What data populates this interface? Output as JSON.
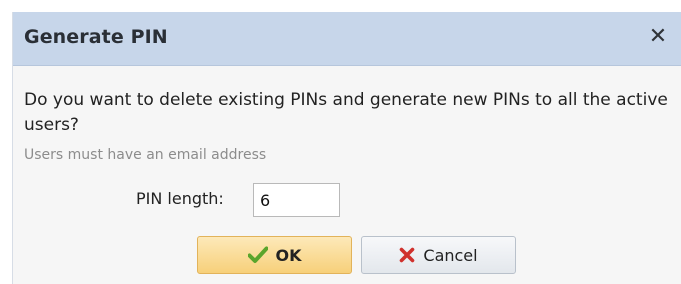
{
  "dialog": {
    "title": "Generate PIN",
    "close_icon": "close-icon",
    "question": "Do you want to delete existing PINs and generate new PINs to all the active users?",
    "hint": "Users must have an email address",
    "pin_length_label": "PIN length:",
    "pin_length_value": "6",
    "ok_label": "OK",
    "ok_icon": "checkmark-icon",
    "cancel_label": "Cancel",
    "cancel_icon": "x-icon"
  },
  "colors": {
    "titlebar_bg": "#c7d6ea",
    "ok_button": "#f7d07a",
    "checkmark": "#5aa52c",
    "cancel_x": "#d0312d"
  }
}
